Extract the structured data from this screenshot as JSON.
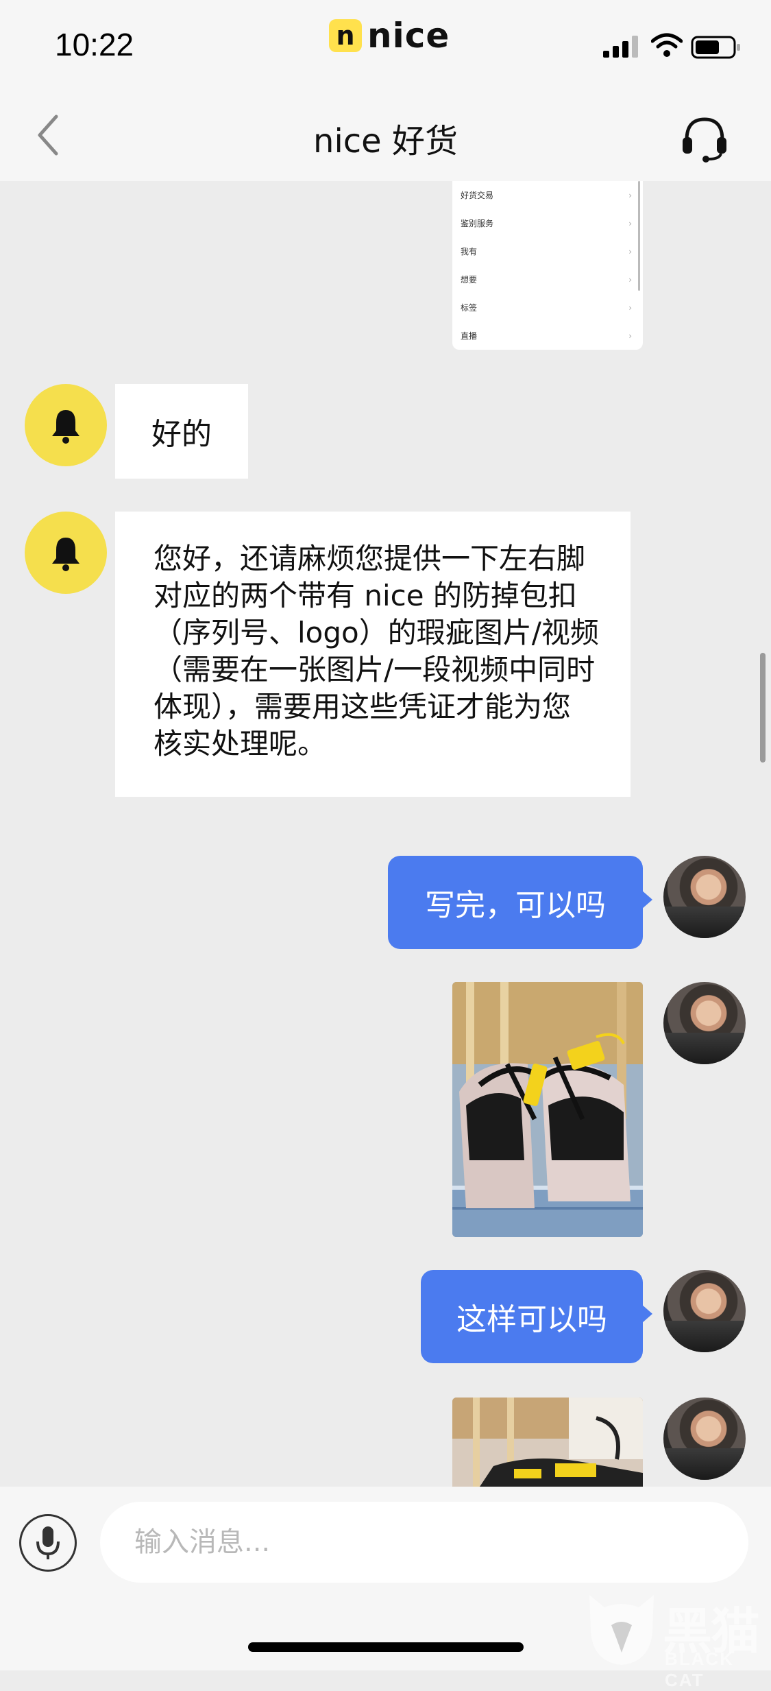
{
  "status_bar": {
    "time": "10:22",
    "brand_mark": "n",
    "brand_word": "nice",
    "icons": [
      "signal-icon",
      "wifi-icon",
      "battery-icon"
    ]
  },
  "nav": {
    "title": "nice 好货",
    "back_icon": "chevron-left-icon",
    "support_icon": "headset-icon"
  },
  "menu_screenshot": {
    "items": [
      "好货交易",
      "鉴别服务",
      "我有",
      "想要",
      "标签",
      "直播"
    ]
  },
  "messages": [
    {
      "side": "in",
      "text": "好的"
    },
    {
      "side": "in",
      "text": "您好，还请麻烦您提供一下左右脚对应的两个带有 nice 的防掉包扣（序列号、logo）的瑕疵图片/视频（需要在一张图片/一段视频中同时体现），需要用这些凭证才能为您核实处理呢。"
    },
    {
      "side": "out",
      "text": "写完，可以吗"
    },
    {
      "side": "out",
      "type": "image",
      "subject": "sneakers with yellow tags"
    },
    {
      "side": "out",
      "text": "这样可以吗"
    },
    {
      "side": "out",
      "type": "image",
      "subject": "sneakers with yellow tags"
    }
  ],
  "input": {
    "placeholder": "输入消息..."
  },
  "watermark": {
    "text": "黑猫",
    "sub": "BLACK CAT"
  },
  "colors": {
    "bot_avatar": "#f5df4d",
    "outgoing_bubble": "#4b7bef",
    "background": "#ececec"
  }
}
